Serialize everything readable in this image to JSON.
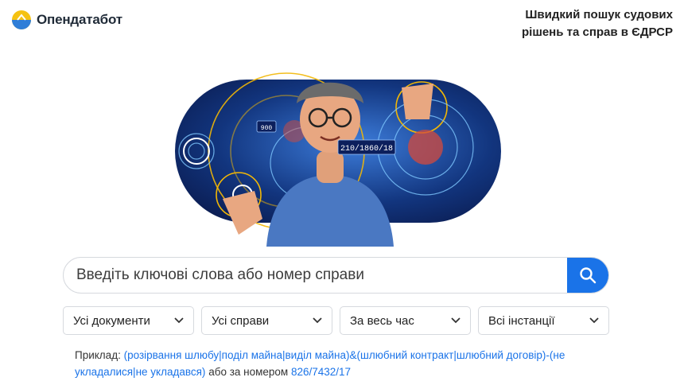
{
  "brand": {
    "name": "Опендатабот",
    "logo_icon": "opendatabot-logo-icon"
  },
  "tagline": {
    "line1": "Швидкий пошук судових",
    "line2": "рішень та справ в ЄДРСР"
  },
  "hero": {
    "case_label": "210/1860/18",
    "small_label": "900",
    "icon": "hero-illustration"
  },
  "search": {
    "placeholder": "Введіть ключові слова або номер справи",
    "value": "",
    "button_icon": "search-icon"
  },
  "filters": [
    {
      "label": "Усі документи"
    },
    {
      "label": "Усі справи"
    },
    {
      "label": "За весь час"
    },
    {
      "label": "Всі інстанції"
    }
  ],
  "example": {
    "prefix": "Приклад:",
    "query": "(розірвання шлюбу|поділ майна|виділ майна)&(шлюбний контракт|шлюбний договір)-(не укладалися|не укладався)",
    "middle": "або за номером",
    "case_number": "826/7432/17"
  },
  "colors": {
    "accent": "#1a73e8",
    "hero_dark": "#0c1f5c",
    "hero_ring": "#f2b705"
  }
}
